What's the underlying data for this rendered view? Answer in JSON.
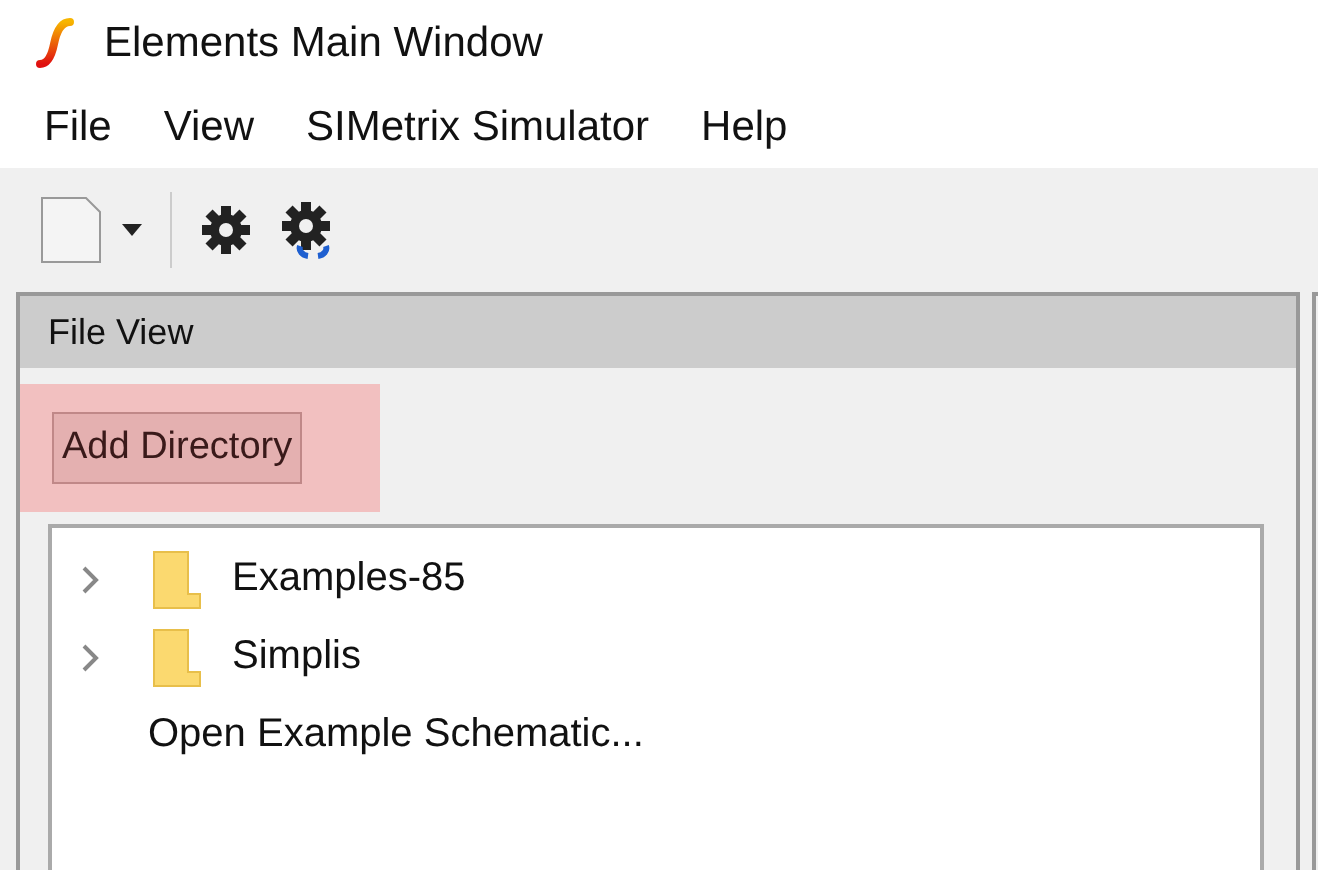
{
  "window": {
    "title": "Elements Main Window"
  },
  "menu": [
    "File",
    "View",
    "SIMetrix Simulator",
    "Help"
  ],
  "toolbar": [
    {
      "kind": "new"
    },
    {
      "kind": "gear"
    },
    {
      "kind": "gear-sync"
    }
  ],
  "panel": {
    "title": "File View",
    "button": {
      "label": "Add Directory",
      "highlighted": true
    },
    "tree": [
      {
        "kind": "folder",
        "label": "Examples-85",
        "expanded": false
      },
      {
        "kind": "folder",
        "label": "Simplis",
        "expanded": false
      },
      {
        "kind": "action",
        "label": "Open Example Schematic..."
      }
    ]
  }
}
